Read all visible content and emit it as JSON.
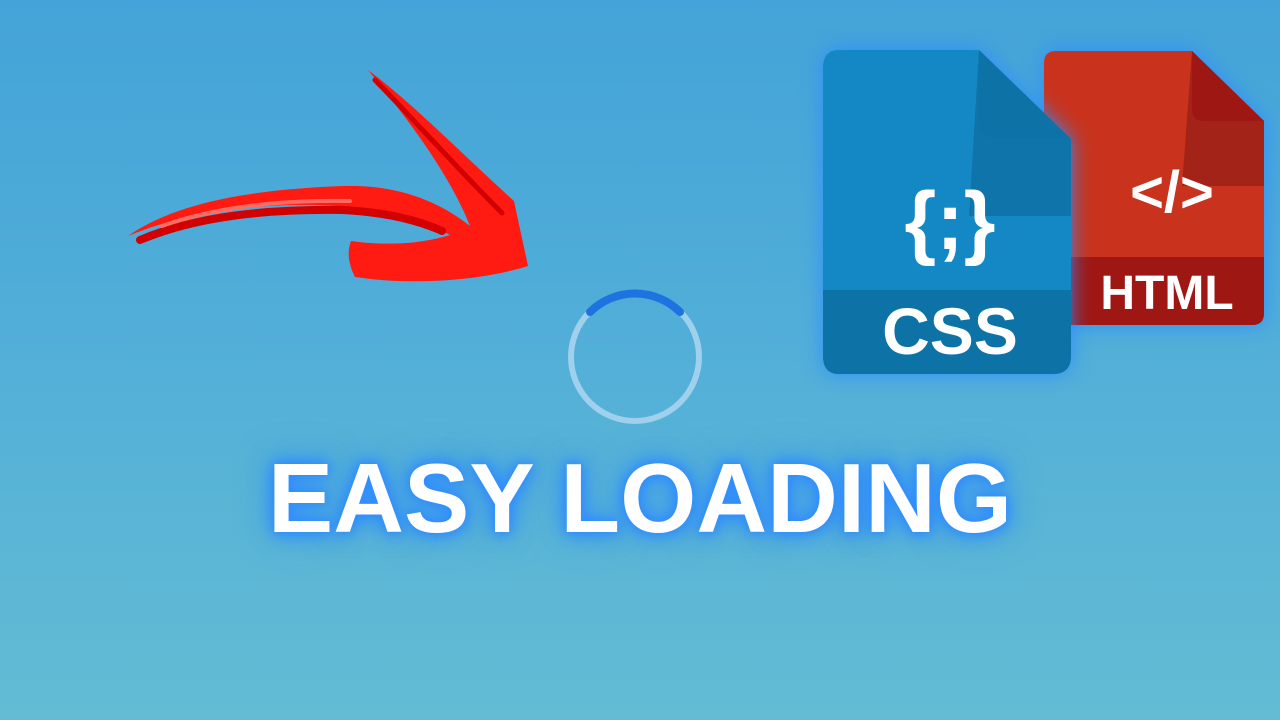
{
  "headline": "EASY LOADING",
  "icons": {
    "arrow": "red-arrow-icon",
    "spinner": "loading-spinner-icon",
    "css_file": "css-file-icon",
    "html_file": "html-file-icon"
  },
  "css_file": {
    "symbol": "{;}",
    "label": "CSS"
  },
  "html_file": {
    "symbol": "</>",
    "label": "HTML"
  },
  "colors": {
    "background_top": "#44a3d8",
    "background_bottom": "#63bcd4",
    "arrow": "#ff1a12",
    "spinner_active": "#1d73df",
    "spinner_track": "#9fd0ec",
    "css_blue": "#1388c4",
    "html_red": "#c9331d",
    "headline_glow": "#2f8cff"
  }
}
